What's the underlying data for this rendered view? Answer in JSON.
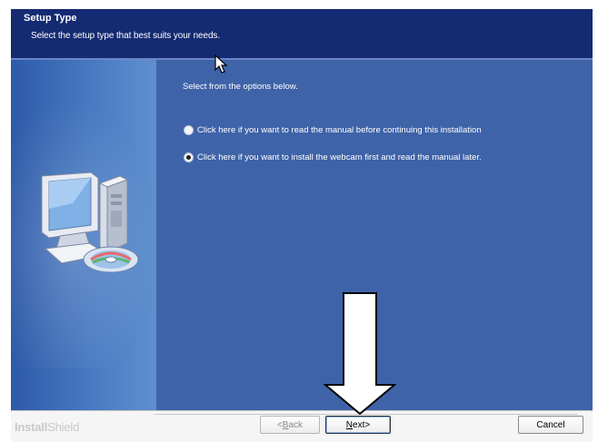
{
  "header": {
    "title": "Setup Type",
    "subtitle": "Select the setup type that best suits your needs."
  },
  "main": {
    "intro": "Select from the options below.",
    "options": [
      {
        "label": "Click here if you want to read the manual before continuing this installation",
        "selected": false
      },
      {
        "label": "Click here if you want to install the webcam first and read the manual later.",
        "selected": true
      }
    ]
  },
  "footer": {
    "brand_bold": "Install",
    "brand_light": "Shield",
    "back": {
      "key": "B",
      "rest": "ack",
      "prefix": "< "
    },
    "next": {
      "key": "N",
      "rest": "ext",
      "suffix": " >"
    },
    "cancel_label": "Cancel"
  },
  "colors": {
    "header_bg": "#142a72",
    "main_bg": "#3f63a8",
    "annotation_arrow": "#ffffff"
  },
  "icons": {
    "illustration": "computer-with-cd-icon",
    "pointer": "mouse-pointer-icon",
    "annotation": "down-arrow-icon"
  }
}
